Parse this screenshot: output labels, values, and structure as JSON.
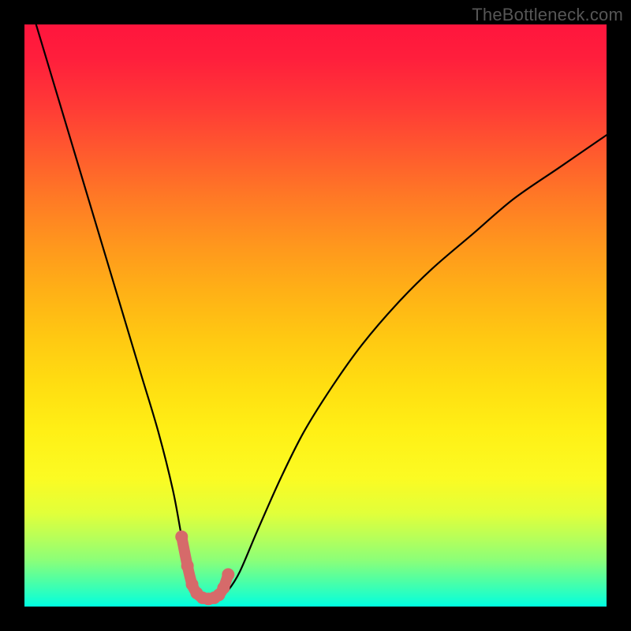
{
  "watermark": "TheBottleneck.com",
  "chart_data": {
    "type": "line",
    "title": "",
    "xlabel": "",
    "ylabel": "",
    "xlim": [
      0,
      100
    ],
    "ylim": [
      0,
      100
    ],
    "series": [
      {
        "name": "bottleneck-curve",
        "x": [
          2,
          5,
          8,
          11,
          14,
          17,
          20,
          23,
          25.5,
          27,
          28.2,
          29.3,
          30.5,
          32,
          33.5,
          35,
          37,
          40,
          44,
          48,
          53,
          58,
          64,
          70,
          77,
          84,
          92,
          100
        ],
        "y": [
          100,
          90,
          80,
          70,
          60,
          50,
          40,
          30,
          20,
          12,
          6,
          2.5,
          1.5,
          1.3,
          1.6,
          2.8,
          6,
          13,
          22,
          30,
          38,
          45,
          52,
          58,
          64,
          70,
          75.5,
          81
        ]
      }
    ],
    "markers": {
      "name": "curve-dots",
      "color": "#d66a6a",
      "x": [
        27.0,
        28.0,
        28.8,
        29.6,
        30.6,
        31.6,
        32.6,
        33.4,
        34.2,
        35.0
      ],
      "y": [
        12.0,
        7.0,
        3.8,
        2.3,
        1.5,
        1.3,
        1.5,
        2.0,
        3.2,
        5.5
      ]
    },
    "gradient_stops": [
      {
        "pos": 0.0,
        "color": "#ff153d"
      },
      {
        "pos": 0.38,
        "color": "#ff971d"
      },
      {
        "pos": 0.7,
        "color": "#fff016"
      },
      {
        "pos": 1.0,
        "color": "#00ffe0"
      }
    ]
  }
}
